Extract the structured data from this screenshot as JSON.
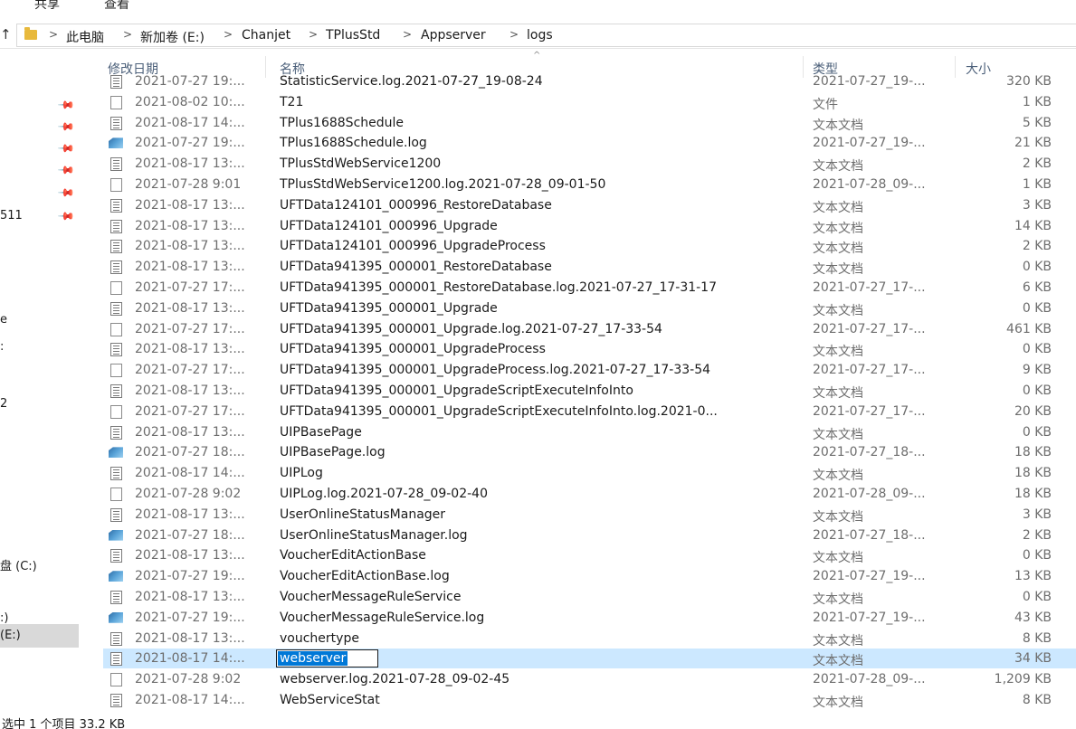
{
  "ribbon": {
    "share": "共享",
    "view": "查看"
  },
  "address": {
    "up_icon": "↑",
    "crumbs": [
      "此电脑",
      "新加卷 (E:)",
      "Chanjet",
      "TPlusStd",
      "Appserver",
      "logs"
    ],
    "separator": ">"
  },
  "sidebar": {
    "pin_icon": "pin-icon",
    "pin_glyph": "📌",
    "frag_511": "511",
    "frag_e": "e",
    "frag_colon1": ":",
    "frag_2": "2",
    "drive_c": "盘 (C:)",
    "drive_e": "(E:)",
    "drive_x": ":)"
  },
  "columns": {
    "date": "修改日期",
    "name": "名称",
    "type": "类型",
    "size": "大小",
    "sort_arrow": "^"
  },
  "rows": [
    {
      "icon": "text-file",
      "date": "2021-07-27 19:...",
      "name": "StatisticService.log.2021-07-27_19-08-24",
      "type": "2021-07-27_19-...",
      "size": "320 KB"
    },
    {
      "icon": "file",
      "date": "2021-08-02 10:...",
      "name": "T21",
      "type": "文件",
      "size": "1 KB"
    },
    {
      "icon": "text-file",
      "date": "2021-08-17 14:...",
      "name": "TPlus1688Schedule",
      "type": "文本文档",
      "size": "5 KB"
    },
    {
      "icon": "log-file",
      "date": "2021-07-27 19:...",
      "name": "TPlus1688Schedule.log",
      "type": "2021-07-27_19-...",
      "size": "21 KB"
    },
    {
      "icon": "text-file",
      "date": "2021-08-17 13:...",
      "name": "TPlusStdWebService1200",
      "type": "文本文档",
      "size": "2 KB"
    },
    {
      "icon": "file",
      "date": "2021-07-28 9:01",
      "name": "TPlusStdWebService1200.log.2021-07-28_09-01-50",
      "type": "2021-07-28_09-...",
      "size": "1 KB"
    },
    {
      "icon": "text-file",
      "date": "2021-08-17 13:...",
      "name": "UFTData124101_000996_RestoreDatabase",
      "type": "文本文档",
      "size": "3 KB"
    },
    {
      "icon": "text-file",
      "date": "2021-08-17 13:...",
      "name": "UFTData124101_000996_Upgrade",
      "type": "文本文档",
      "size": "14 KB"
    },
    {
      "icon": "text-file",
      "date": "2021-08-17 13:...",
      "name": "UFTData124101_000996_UpgradeProcess",
      "type": "文本文档",
      "size": "2 KB"
    },
    {
      "icon": "text-file",
      "date": "2021-08-17 13:...",
      "name": "UFTData941395_000001_RestoreDatabase",
      "type": "文本文档",
      "size": "0 KB"
    },
    {
      "icon": "file",
      "date": "2021-07-27 17:...",
      "name": "UFTData941395_000001_RestoreDatabase.log.2021-07-27_17-31-17",
      "type": "2021-07-27_17-...",
      "size": "6 KB"
    },
    {
      "icon": "text-file",
      "date": "2021-08-17 13:...",
      "name": "UFTData941395_000001_Upgrade",
      "type": "文本文档",
      "size": "0 KB"
    },
    {
      "icon": "file",
      "date": "2021-07-27 17:...",
      "name": "UFTData941395_000001_Upgrade.log.2021-07-27_17-33-54",
      "type": "2021-07-27_17-...",
      "size": "461 KB"
    },
    {
      "icon": "text-file",
      "date": "2021-08-17 13:...",
      "name": "UFTData941395_000001_UpgradeProcess",
      "type": "文本文档",
      "size": "0 KB"
    },
    {
      "icon": "file",
      "date": "2021-07-27 17:...",
      "name": "UFTData941395_000001_UpgradeProcess.log.2021-07-27_17-33-54",
      "type": "2021-07-27_17-...",
      "size": "9 KB"
    },
    {
      "icon": "text-file",
      "date": "2021-08-17 13:...",
      "name": "UFTData941395_000001_UpgradeScriptExecuteInfoInto",
      "type": "文本文档",
      "size": "0 KB"
    },
    {
      "icon": "file",
      "date": "2021-07-27 17:...",
      "name": "UFTData941395_000001_UpgradeScriptExecuteInfoInto.log.2021-0...",
      "type": "2021-07-27_17-...",
      "size": "20 KB"
    },
    {
      "icon": "text-file",
      "date": "2021-08-17 13:...",
      "name": "UIPBasePage",
      "type": "文本文档",
      "size": "0 KB"
    },
    {
      "icon": "log-file",
      "date": "2021-07-27 18:...",
      "name": "UIPBasePage.log",
      "type": "2021-07-27_18-...",
      "size": "18 KB"
    },
    {
      "icon": "text-file",
      "date": "2021-08-17 14:...",
      "name": "UIPLog",
      "type": "文本文档",
      "size": "18 KB"
    },
    {
      "icon": "file",
      "date": "2021-07-28 9:02",
      "name": "UIPLog.log.2021-07-28_09-02-40",
      "type": "2021-07-28_09-...",
      "size": "18 KB"
    },
    {
      "icon": "text-file",
      "date": "2021-08-17 13:...",
      "name": "UserOnlineStatusManager",
      "type": "文本文档",
      "size": "3 KB"
    },
    {
      "icon": "log-file",
      "date": "2021-07-27 18:...",
      "name": "UserOnlineStatusManager.log",
      "type": "2021-07-27_18-...",
      "size": "2 KB"
    },
    {
      "icon": "text-file",
      "date": "2021-08-17 13:...",
      "name": "VoucherEditActionBase",
      "type": "文本文档",
      "size": "0 KB"
    },
    {
      "icon": "log-file",
      "date": "2021-07-27 19:...",
      "name": "VoucherEditActionBase.log",
      "type": "2021-07-27_19-...",
      "size": "13 KB"
    },
    {
      "icon": "text-file",
      "date": "2021-08-17 13:...",
      "name": "VoucherMessageRuleService",
      "type": "文本文档",
      "size": "0 KB"
    },
    {
      "icon": "log-file",
      "date": "2021-07-27 19:...",
      "name": "VoucherMessageRuleService.log",
      "type": "2021-07-27_19-...",
      "size": "43 KB"
    },
    {
      "icon": "text-file",
      "date": "2021-08-17 13:...",
      "name": "vouchertype",
      "type": "文本文档",
      "size": "8 KB"
    },
    {
      "icon": "text-file",
      "date": "2021-08-17 14:...",
      "name": "webserver",
      "type": "文本文档",
      "size": "34 KB",
      "selected": true,
      "renaming": true
    },
    {
      "icon": "file",
      "date": "2021-07-28 9:02",
      "name": "webserver.log.2021-07-28_09-02-45",
      "type": "2021-07-28_09-...",
      "size": "1,209 KB"
    },
    {
      "icon": "text-file",
      "date": "2021-08-17 14:...",
      "name": "WebServiceStat",
      "type": "文本文档",
      "size": "8 KB"
    }
  ],
  "status": {
    "text": "选中 1 个项目  33.2 KB"
  },
  "colors": {
    "selected_row": "#cce8ff",
    "rename_highlight": "#0078d7",
    "header_text": "#4c607a"
  }
}
